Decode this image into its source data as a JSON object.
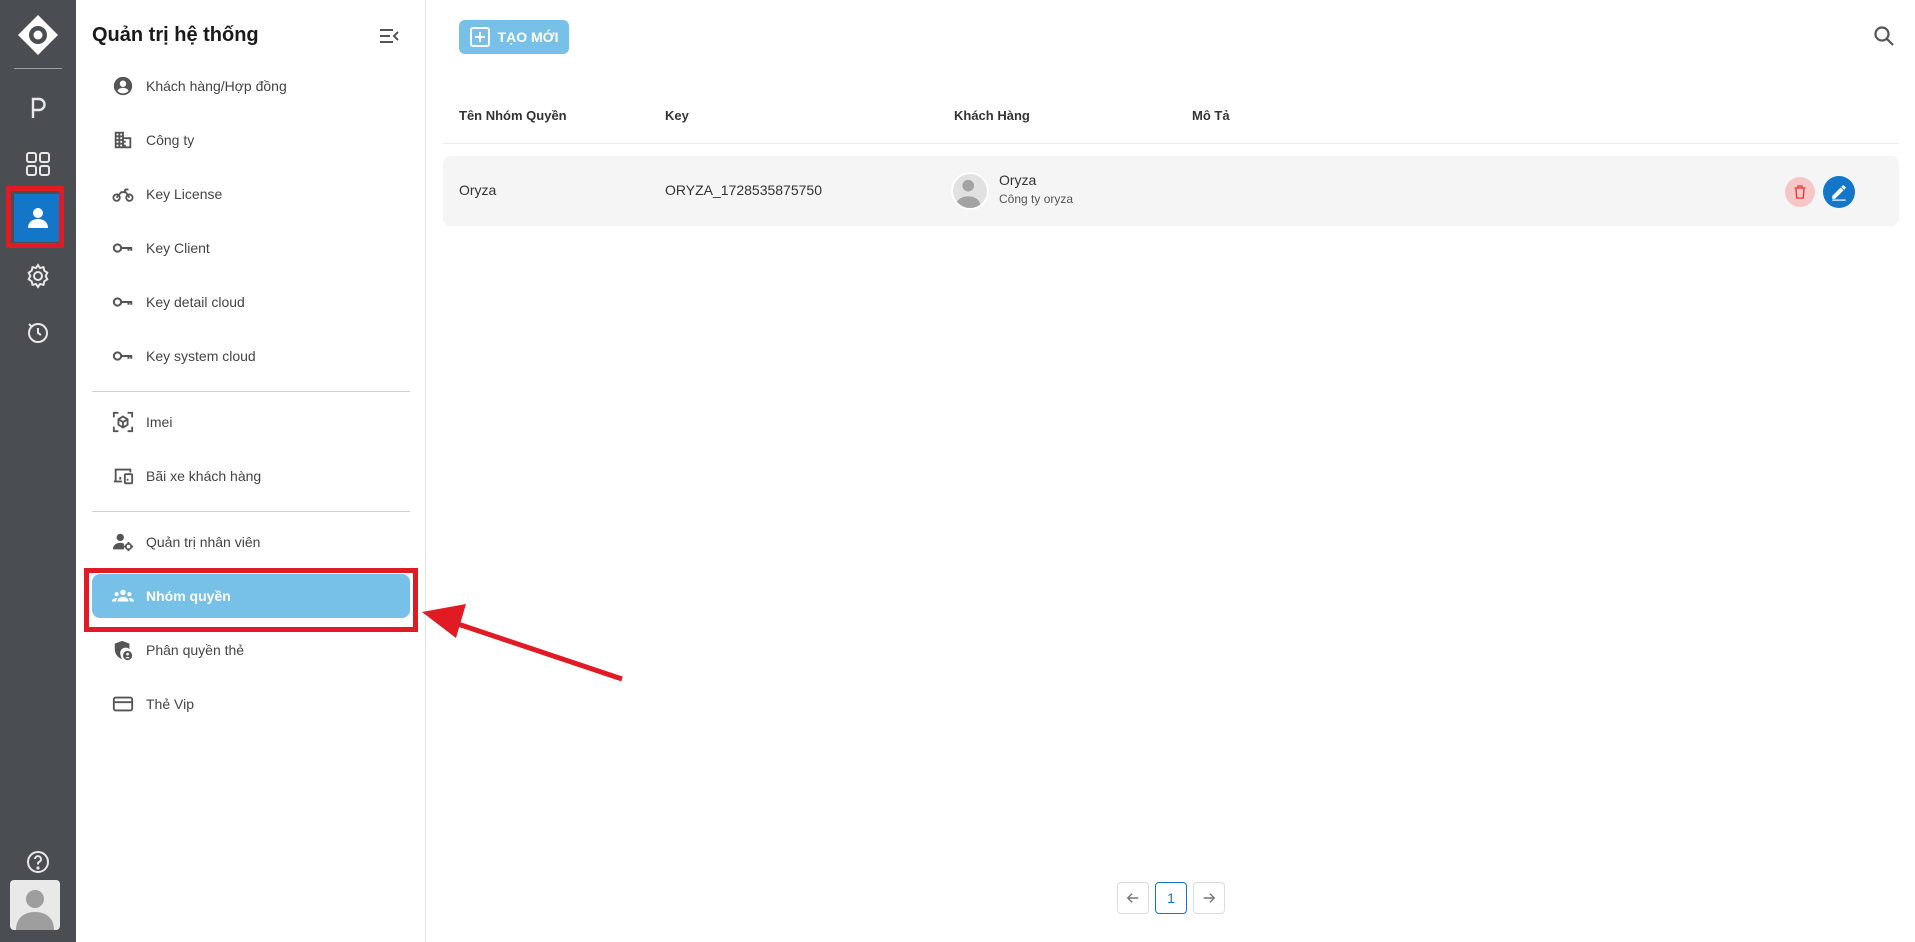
{
  "colors": {
    "rail_bg": "#4a4d52",
    "accent": "#1376c9",
    "active_item": "#77c0e8",
    "annotation": "#e01b24"
  },
  "rail": {
    "icons": [
      "logo-icon",
      "parking-icon",
      "grid-icon",
      "user-icon",
      "settings-icon",
      "history-icon",
      "help-icon"
    ],
    "active": "user-icon"
  },
  "sidebar": {
    "title": "Quản trị hệ thống",
    "groups": [
      [
        {
          "label": "Khách hàng/Hợp đồng",
          "icon": "account-circle-icon"
        },
        {
          "label": "Công ty",
          "icon": "building-icon"
        },
        {
          "label": "Key License",
          "icon": "motorbike-icon"
        },
        {
          "label": "Key Client",
          "icon": "key-icon"
        },
        {
          "label": "Key detail cloud",
          "icon": "key-icon"
        },
        {
          "label": "Key system cloud",
          "icon": "key-icon"
        }
      ],
      [
        {
          "label": "Imei",
          "icon": "scan-cube-icon"
        },
        {
          "label": "Bãi xe khách hàng",
          "icon": "devices-icon"
        }
      ],
      [
        {
          "label": "Quản trị nhân viên",
          "icon": "user-gear-icon"
        },
        {
          "label": "Nhóm quyền",
          "icon": "group-icon",
          "active": true
        },
        {
          "label": "Phân quyền thẻ",
          "icon": "shield-user-icon"
        },
        {
          "label": "Thẻ Vip",
          "icon": "card-icon"
        }
      ]
    ]
  },
  "toolbar": {
    "create_label": "TẠO MỚI"
  },
  "table": {
    "columns": [
      "Tên Nhóm Quyền",
      "Key",
      "Khách Hàng",
      "Mô Tả"
    ],
    "rows": [
      {
        "name": "Oryza",
        "key": "ORYZA_1728535875750",
        "customer_name": "Oryza",
        "customer_company": "Công ty oryza",
        "description": ""
      }
    ]
  },
  "pagination": {
    "current": "1"
  }
}
